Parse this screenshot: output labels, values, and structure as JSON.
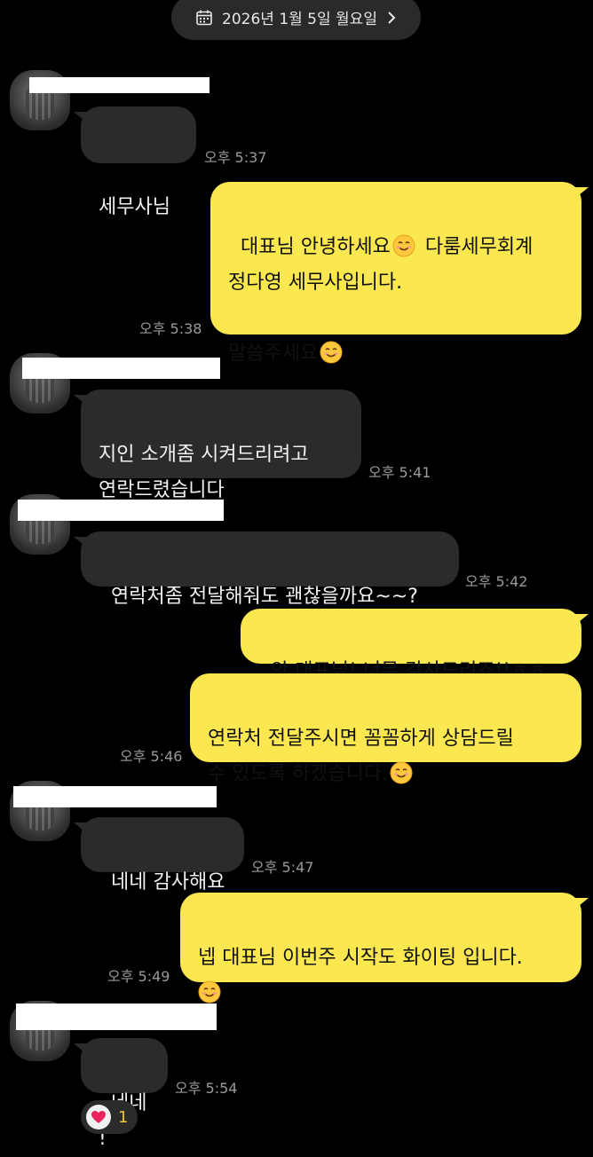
{
  "date_bar": {
    "label": "2026년 1월 5일 월요일",
    "icon": "calendar-icon",
    "chevron": "chevron-right-icon"
  },
  "messages": [
    {
      "sender": "other",
      "name": "",
      "text": "세무사님",
      "time": "오후 5:37"
    },
    {
      "sender": "me",
      "lines": [
        "대표님 안녕하세요",
        "다룸세무회계",
        "정다영 세무사입니다.",
        "",
        "말씀주세요"
      ],
      "time": "오후 5:38"
    },
    {
      "sender": "other",
      "name": "",
      "lines": [
        "지인 소개좀 시켜드리려고",
        "연락드렸습니다"
      ],
      "time": "오후 5:41"
    },
    {
      "sender": "other",
      "name": "",
      "text": "연락처좀 전달해줘도 괜찮을까요~~?",
      "time": "오후 5:42"
    },
    {
      "sender": "me",
      "text": "앗 대표님! 너무 감사드리죠!!ㅎㅎ",
      "time": ""
    },
    {
      "sender": "me",
      "lines": [
        "연락처 전달주시면 꼼꼼하게 상담드릴",
        "수 있도록 하겠습니다."
      ],
      "time": "오후 5:46"
    },
    {
      "sender": "other",
      "name": "",
      "text": "네네 감사해요",
      "time": "오후 5:47"
    },
    {
      "sender": "me",
      "lines": [
        "넵 대표님 이번주 시작도 화이팅 입니다."
      ],
      "time": "오후 5:49"
    },
    {
      "sender": "other",
      "name": "",
      "text": "네네 !",
      "time": "오후 5:54"
    }
  ],
  "reaction": {
    "icon": "heart-icon",
    "count": "1"
  },
  "colors": {
    "background": "#000000",
    "incoming_bubble": "#2b2b2b",
    "outgoing_bubble": "#fbe74f",
    "reaction_count": "#f0c53a",
    "heart": "#e8245c"
  }
}
